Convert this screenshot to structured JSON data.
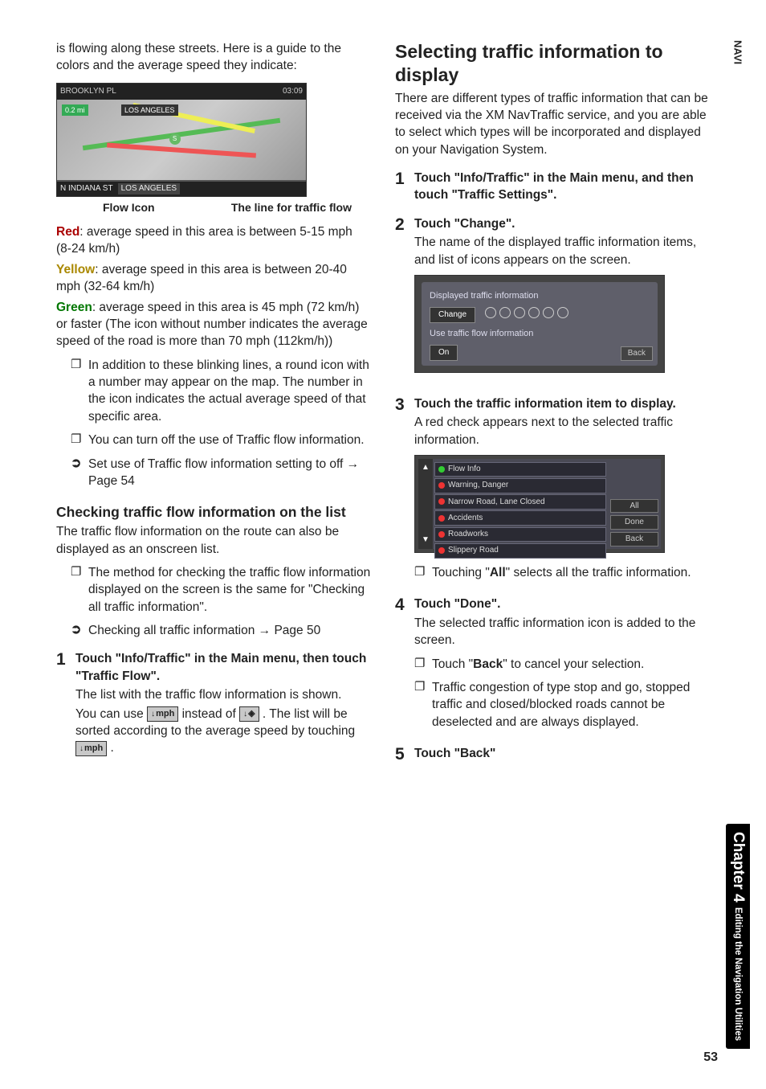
{
  "page_number": "53",
  "sidebar": {
    "navi": "NAVI",
    "chapter": "Chapter 4",
    "subtitle": "Editing the Navigation Utilities"
  },
  "left_col": {
    "intro": "is flowing along these streets. Here is a guide to the colors and the average speed they indicate:",
    "fig1": {
      "topleft": "BROOKLYN PL",
      "dist": "0.2 mi",
      "time": "03:09",
      "city": "LOS ANGELES",
      "bottomleft": "N INDIANA ST",
      "bottomright": "LOS ANGELES"
    },
    "fig1_label_left": "Flow Icon",
    "fig1_label_right": "The line for traffic flow",
    "red_label": "Red",
    "red_text": ": average speed in this area is between 5-15 mph (8-24 km/h)",
    "yellow_label": "Yellow",
    "yellow_text": ": average speed in this area is between 20-40 mph (32-64 km/h)",
    "green_label": "Green",
    "green_text": ": average speed in this area is 45 mph (72 km/h) or faster (The icon without number indicates the average speed of the road is more than 70 mph (112km/h))",
    "bullet1": "In addition to these blinking lines, a round icon with a number may appear on the map. The number in the icon indicates the actual average speed of that specific area.",
    "bullet2": "You can turn off the use of Traffic flow information.",
    "crossref1_a": "Set use of Traffic flow information setting to off",
    "crossref1_b": "Page 54",
    "sub1": "Checking traffic flow information on the list",
    "sub1_text": "The traffic flow information on the route can also be displayed as an onscreen list.",
    "bullet3": "The method for checking the traffic flow information displayed on the screen is the same for \"Checking all traffic information\".",
    "crossref2_a": "Checking all traffic information",
    "crossref2_b": "Page 50",
    "step1_lead": "Touch \"Info/Traffic\" in the Main menu, then touch \"Traffic Flow\".",
    "step1_desc": "The list with the traffic flow information is shown.",
    "step1_after_a": "You can use ",
    "step1_btn1": "mph",
    "step1_after_b": " instead of ",
    "step1_btn2": " ",
    "step1_after_c": ". The list will be sorted according to the average speed by touching ",
    "step1_btn3": "mph",
    "step1_after_d": "."
  },
  "right_col": {
    "heading": "Selecting traffic information to display",
    "intro": "There are different types of traffic information that can be received via the XM NavTraffic service, and you are able to select which types will be incorporated and displayed on your Navigation System.",
    "step1_lead": "Touch \"Info/Traffic\" in the Main menu, and then touch \"Traffic Settings\".",
    "step2_lead": "Touch \"Change\".",
    "step2_desc": "The name of the displayed traffic information items, and list of icons appears on the screen.",
    "fig2": {
      "line1": "Displayed traffic information",
      "btn_change": "Change",
      "line2": "Use traffic flow information",
      "btn_on": "On",
      "btn_back": "Back"
    },
    "step3_lead": "Touch the traffic information item to display.",
    "step3_desc": "A red check appears next to the selected traffic information.",
    "fig3": {
      "items": [
        "Flow Info",
        "Warning, Danger",
        "Narrow Road, Lane Closed",
        "Accidents",
        "Roadworks",
        "Slippery Road"
      ],
      "btn_all": "All",
      "btn_done": "Done",
      "btn_back": "Back"
    },
    "step3_note_a": "Touching \"",
    "step3_note_bold": "All",
    "step3_note_b": "\" selects all the traffic information.",
    "step4_lead": "Touch \"Done\".",
    "step4_desc": "The selected traffic information icon is added to the screen.",
    "step4_bullet1_a": "Touch \"",
    "step4_bullet1_bold": "Back",
    "step4_bullet1_b": "\" to cancel your selection.",
    "step4_bullet2": "Traffic congestion of type stop and go, stopped traffic and closed/blocked roads cannot be deselected and are always displayed.",
    "step5_lead": "Touch \"Back\""
  }
}
